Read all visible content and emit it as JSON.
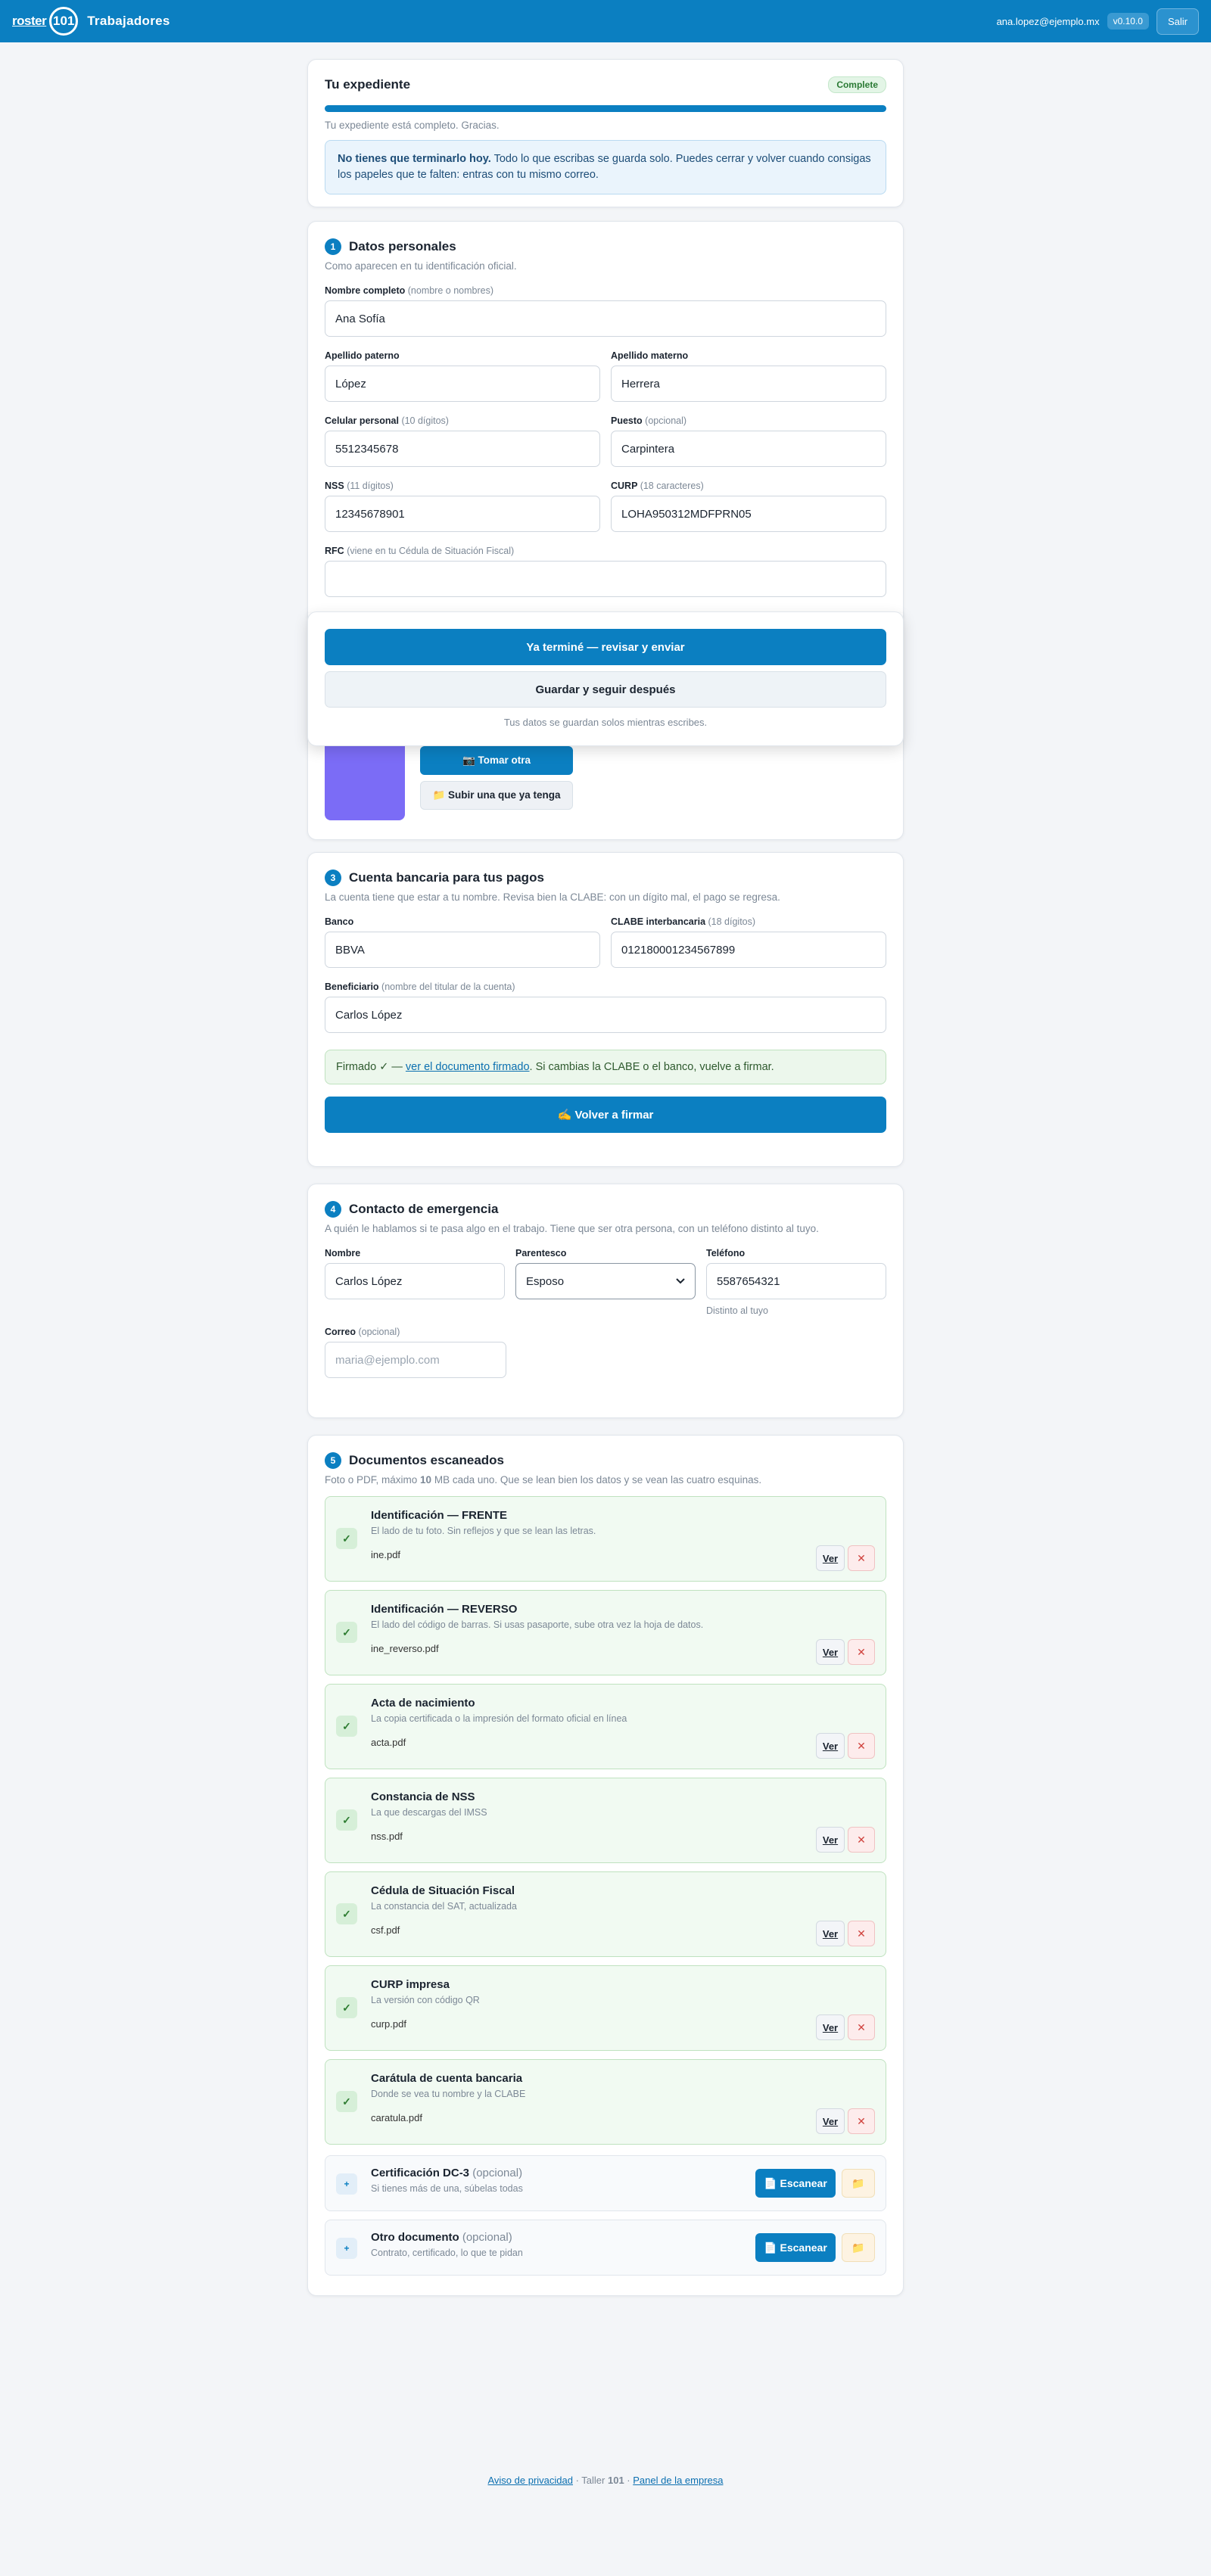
{
  "header": {
    "logo_word": "roster",
    "logo_num": "101",
    "title": "Trabajadores",
    "user_email": "ana.lopez@ejemplo.mx",
    "version": "v0.10.0",
    "exit_label": "Salir"
  },
  "status": {
    "title": "Tu expediente",
    "badge": "Complete",
    "progress_fraction": 1.0,
    "message": "Tu expediente está completo. Gracias.",
    "info_bold": "No tienes que terminarlo hoy.",
    "info_text": "Todo lo que escribas se guarda solo. Puedes cerrar y volver cuando consigas los papeles que te falten: entras con tu mismo correo."
  },
  "personal": {
    "num": "1",
    "title": "Datos personales",
    "subtitle": "Como aparecen en tu identificación oficial.",
    "name_label": "Nombre completo",
    "name_hint": "(nombre o nombres)",
    "name_value": "Ana Sofía",
    "paterno_label": "Apellido paterno",
    "paterno_value": "López",
    "materno_label": "Apellido materno",
    "materno_value": "Herrera",
    "cel_label": "Celular personal",
    "cel_hint": "(10 dígitos)",
    "cel_value": "5512345678",
    "puesto_label": "Puesto",
    "puesto_hint": "(opcional)",
    "puesto_value": "Carpintera",
    "nss_label": "NSS",
    "nss_hint": "(11 dígitos)",
    "nss_value": "12345678901",
    "curp_label": "CURP",
    "curp_hint": "(18 caracteres)",
    "curp_value": "LOHA950312MDFPRN05",
    "rfc_label": "RFC",
    "rfc_hint": "(viene en tu Cédula de Situación Fiscal)"
  },
  "floating": {
    "submit_label": "Ya terminé — revisar y enviar",
    "save_label": "Guardar y seguir después",
    "note": "Tus datos se guardan solos mientras escribes."
  },
  "photo": {
    "retake_label": "📷 Tomar otra",
    "upload_label": "📁 Subir una que ya tenga",
    "swatch_color": "#7b6cf6"
  },
  "bank": {
    "num": "3",
    "title": "Cuenta bancaria para tus pagos",
    "subtitle": "La cuenta tiene que estar a tu nombre. Revisa bien la CLABE: con un dígito mal, el pago se regresa.",
    "bank_label": "Banco",
    "bank_value": "BBVA",
    "clabe_label": "CLABE interbancaria",
    "clabe_hint": "(18 dígitos)",
    "clabe_value": "012180001234567899",
    "benef_label": "Beneficiario",
    "benef_hint": "(nombre del titular de la cuenta)",
    "benef_value": "Carlos López",
    "signed_prefix": "Firmado ✓ — ",
    "signed_link": "ver el documento firmado",
    "signed_suffix": ". Si cambias la CLABE o el banco, vuelve a firmar.",
    "resign_label": "✍️ Volver a firmar"
  },
  "emergency": {
    "num": "4",
    "title": "Contacto de emergencia",
    "subtitle": "A quién le hablamos si te pasa algo en el trabajo. Tiene que ser otra persona, con un teléfono distinto al tuyo.",
    "name_label": "Nombre",
    "name_value": "Carlos López",
    "rel_label": "Parentesco",
    "rel_value": "Esposo",
    "phone_label": "Teléfono",
    "phone_value": "5587654321",
    "phone_note": "Distinto al tuyo",
    "email_label": "Correo",
    "email_hint": "(opcional)",
    "email_placeholder": "maria@ejemplo.com"
  },
  "documents": {
    "num": "5",
    "title": "Documentos escaneados",
    "subtitle_pre": "Foto o PDF, máximo ",
    "subtitle_bold": "10",
    "subtitle_post": " MB cada uno. Que se lean bien los datos y se vean las cuatro esquinas.",
    "view_label": "Ver",
    "remove_label": "✕",
    "check_label": "✓",
    "items": [
      {
        "title": "Identificación — FRENTE",
        "desc": "El lado de tu foto. Sin reflejos y que se lean las letras.",
        "file": "ine.pdf"
      },
      {
        "title": "Identificación — REVERSO",
        "desc": "El lado del código de barras. Si usas pasaporte, sube otra vez la hoja de datos.",
        "file": "ine_reverso.pdf"
      },
      {
        "title": "Acta de nacimiento",
        "desc": "La copia certificada o la impresión del formato oficial en línea",
        "file": "acta.pdf"
      },
      {
        "title": "Constancia de NSS",
        "desc": "La que descargas del IMSS",
        "file": "nss.pdf"
      },
      {
        "title": "Cédula de Situación Fiscal",
        "desc": "La constancia del SAT, actualizada",
        "file": "csf.pdf"
      },
      {
        "title": "CURP impresa",
        "desc": "La versión con código QR",
        "file": "curp.pdf"
      },
      {
        "title": "Carátula de cuenta bancaria",
        "desc": "Donde se vea tu nombre y la CLABE",
        "file": "caratula.pdf"
      }
    ],
    "pending": [
      {
        "title": "Certificación DC-3",
        "hint": "(opcional)",
        "desc": "Si tienes más de una, súbelas todas"
      },
      {
        "title": "Otro documento",
        "hint": "(opcional)",
        "desc": "Contrato, certificado, lo que te pidan"
      }
    ],
    "pending_mark": "+",
    "scan_label": "📄 Escanear",
    "folder_label": "📁"
  },
  "footer": {
    "privacy": "Aviso de privacidad",
    "sep1": " · Taller ",
    "taller_num": "101",
    "sep2": " · ",
    "panel": "Panel de la empresa"
  }
}
